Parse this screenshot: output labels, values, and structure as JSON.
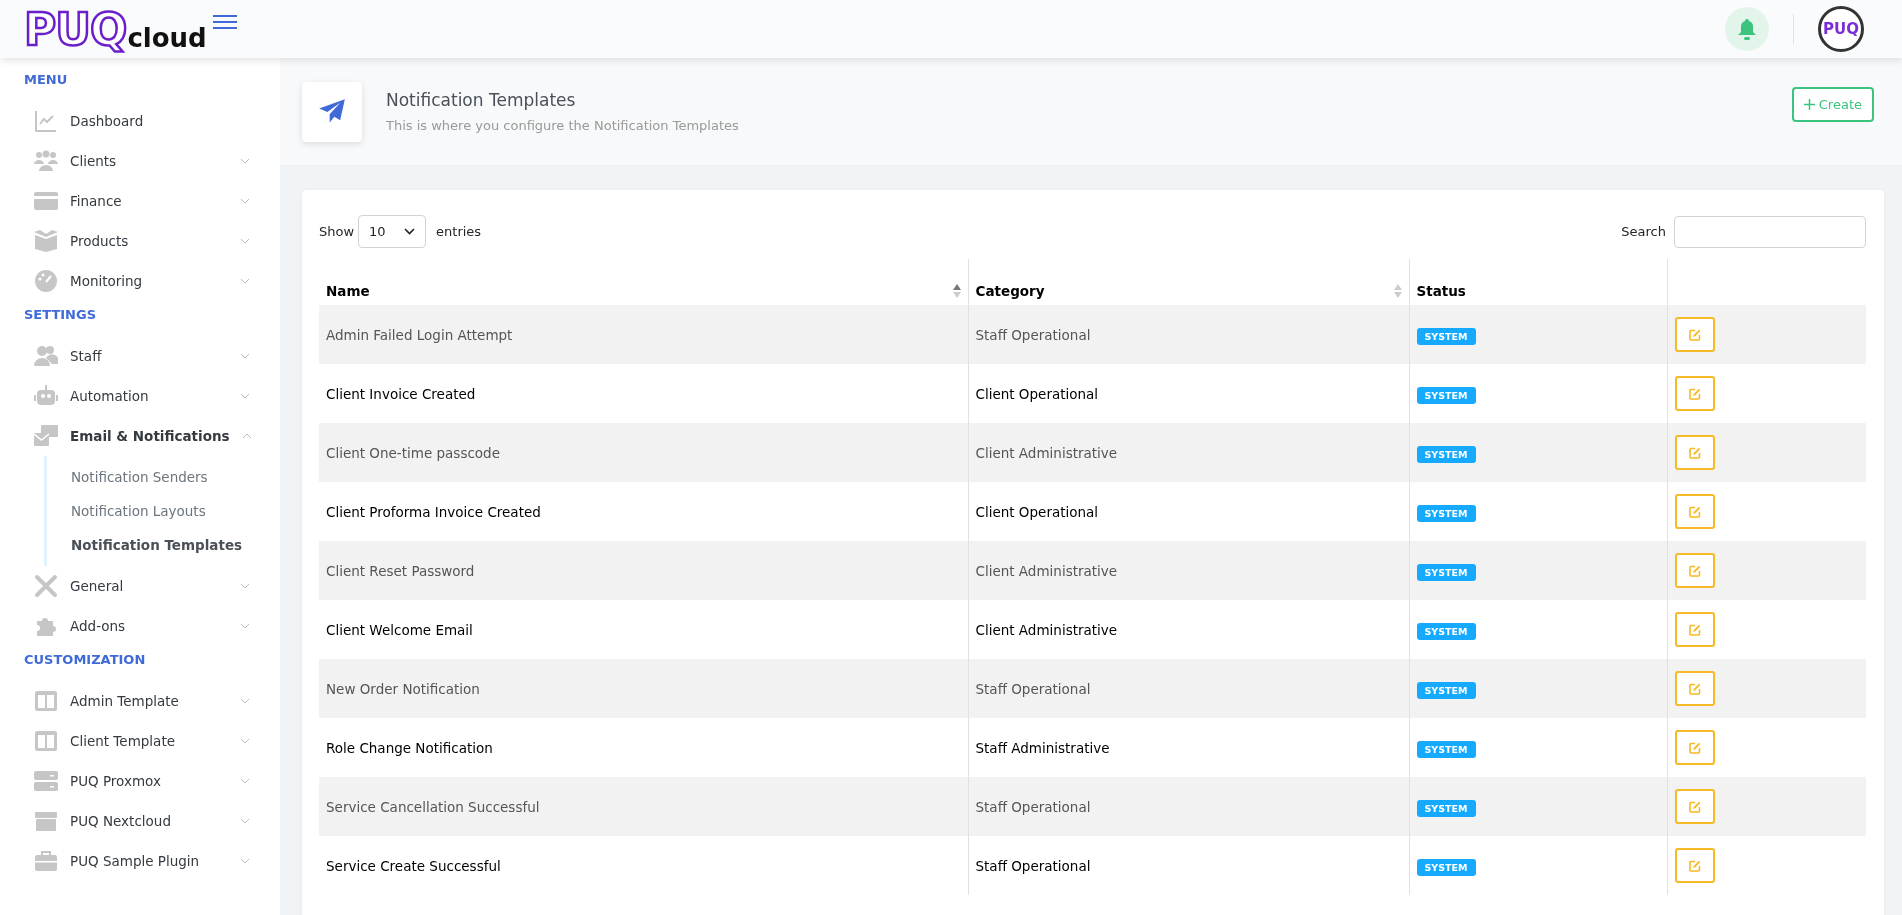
{
  "header": {
    "logo": {
      "mark": "PUQ",
      "word": "cloud"
    },
    "avatar": "PUQ"
  },
  "sidebar": {
    "sections": [
      {
        "title": "MENU",
        "items": [
          {
            "label": "Dashboard"
          },
          {
            "label": "Clients",
            "expanded": false
          },
          {
            "label": "Finance",
            "expanded": false
          },
          {
            "label": "Products",
            "expanded": false
          },
          {
            "label": "Monitoring",
            "expanded": false
          }
        ]
      },
      {
        "title": "SETTINGS",
        "items": [
          {
            "label": "Staff",
            "expanded": false
          },
          {
            "label": "Automation",
            "expanded": false
          },
          {
            "label": "Email & Notifications",
            "expanded": true,
            "children": [
              {
                "label": "Notification Senders",
                "selected": false
              },
              {
                "label": "Notification Layouts",
                "selected": false
              },
              {
                "label": "Notification Templates",
                "selected": true
              }
            ]
          },
          {
            "label": "General",
            "expanded": false
          },
          {
            "label": "Add-ons",
            "expanded": false
          }
        ]
      },
      {
        "title": "CUSTOMIZATION",
        "items": [
          {
            "label": "Admin Template",
            "expanded": false
          },
          {
            "label": "Client Template",
            "expanded": false
          },
          {
            "label": "PUQ Proxmox",
            "expanded": false
          },
          {
            "label": "PUQ Nextcloud",
            "expanded": false
          },
          {
            "label": "PUQ Sample Plugin",
            "expanded": false
          }
        ]
      }
    ]
  },
  "page": {
    "title": "Notification Templates",
    "subtitle": "This is where you configure the Notification Templates",
    "create_button": "Create"
  },
  "table": {
    "show_label": "Show",
    "page_size": "10",
    "entries_label": "entries",
    "search_label": "Search",
    "columns": [
      {
        "label": "Name",
        "sorted": true
      },
      {
        "label": "Category",
        "sorted": false
      },
      {
        "label": "Status"
      }
    ],
    "rows": [
      {
        "name": "Admin Failed Login Attempt",
        "category": "Staff Operational",
        "status": "SYSTEM"
      },
      {
        "name": "Client Invoice Created",
        "category": "Client Operational",
        "status": "SYSTEM"
      },
      {
        "name": "Client One-time passcode",
        "category": "Client Administrative",
        "status": "SYSTEM"
      },
      {
        "name": "Client Proforma Invoice Created",
        "category": "Client Operational",
        "status": "SYSTEM"
      },
      {
        "name": "Client Reset Password",
        "category": "Client Administrative",
        "status": "SYSTEM"
      },
      {
        "name": "Client Welcome Email",
        "category": "Client Administrative",
        "status": "SYSTEM"
      },
      {
        "name": "New Order Notification",
        "category": "Staff Operational",
        "status": "SYSTEM"
      },
      {
        "name": "Role Change Notification",
        "category": "Staff Administrative",
        "status": "SYSTEM"
      },
      {
        "name": "Service Cancellation Successful",
        "category": "Staff Operational",
        "status": "SYSTEM"
      },
      {
        "name": "Service Create Successful",
        "category": "Staff Operational",
        "status": "SYSTEM"
      }
    ]
  }
}
